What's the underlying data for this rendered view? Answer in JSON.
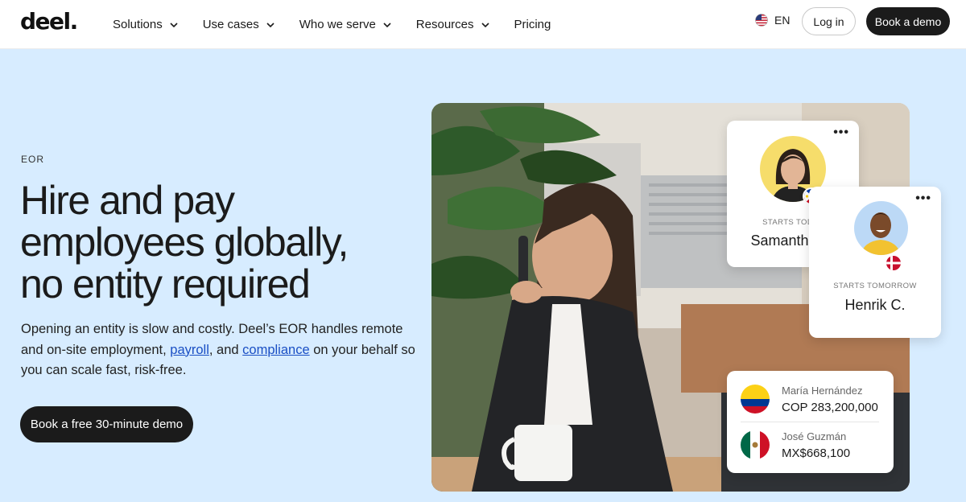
{
  "brand": {
    "logo": "deel."
  },
  "nav": {
    "items": [
      {
        "label": "Solutions"
      },
      {
        "label": "Use cases"
      },
      {
        "label": "Who we serve"
      },
      {
        "label": "Resources"
      },
      {
        "label": "Pricing"
      }
    ],
    "language": "EN",
    "login": "Log in",
    "book_demo": "Book a demo"
  },
  "hero": {
    "eyebrow": "EOR",
    "headline": [
      "Hire and pay",
      "employees globally,",
      "no entity required"
    ],
    "lead": {
      "part1": "Opening an entity is slow and costly. Deel’s EOR handles remote and on-site employment, ",
      "link1": "payroll",
      "part2": ", and ",
      "link2": "compliance",
      "part3": " on your behalf so you can scale fast, risk-free."
    },
    "cta": "Book a free 30-minute demo"
  },
  "cards": {
    "hire1": {
      "status": "STARTS TODAY",
      "name": "Samantha R.",
      "menu": "•••",
      "flag": "philippines-flag"
    },
    "hire2": {
      "status": "STARTS TOMORROW",
      "name": "Henrik C.",
      "menu": "•••",
      "flag": "denmark-flag"
    },
    "payments": [
      {
        "name": "María Hernández",
        "amount": "COP 283,200,000",
        "flag": "colombia-flag"
      },
      {
        "name": "José Guzmán",
        "amount": "MX$668,100",
        "flag": "mexico-flag"
      }
    ]
  },
  "colors": {
    "hero_bg": "#d7ecff",
    "dark": "#1b1b1b",
    "link": "#1a4fc4"
  }
}
